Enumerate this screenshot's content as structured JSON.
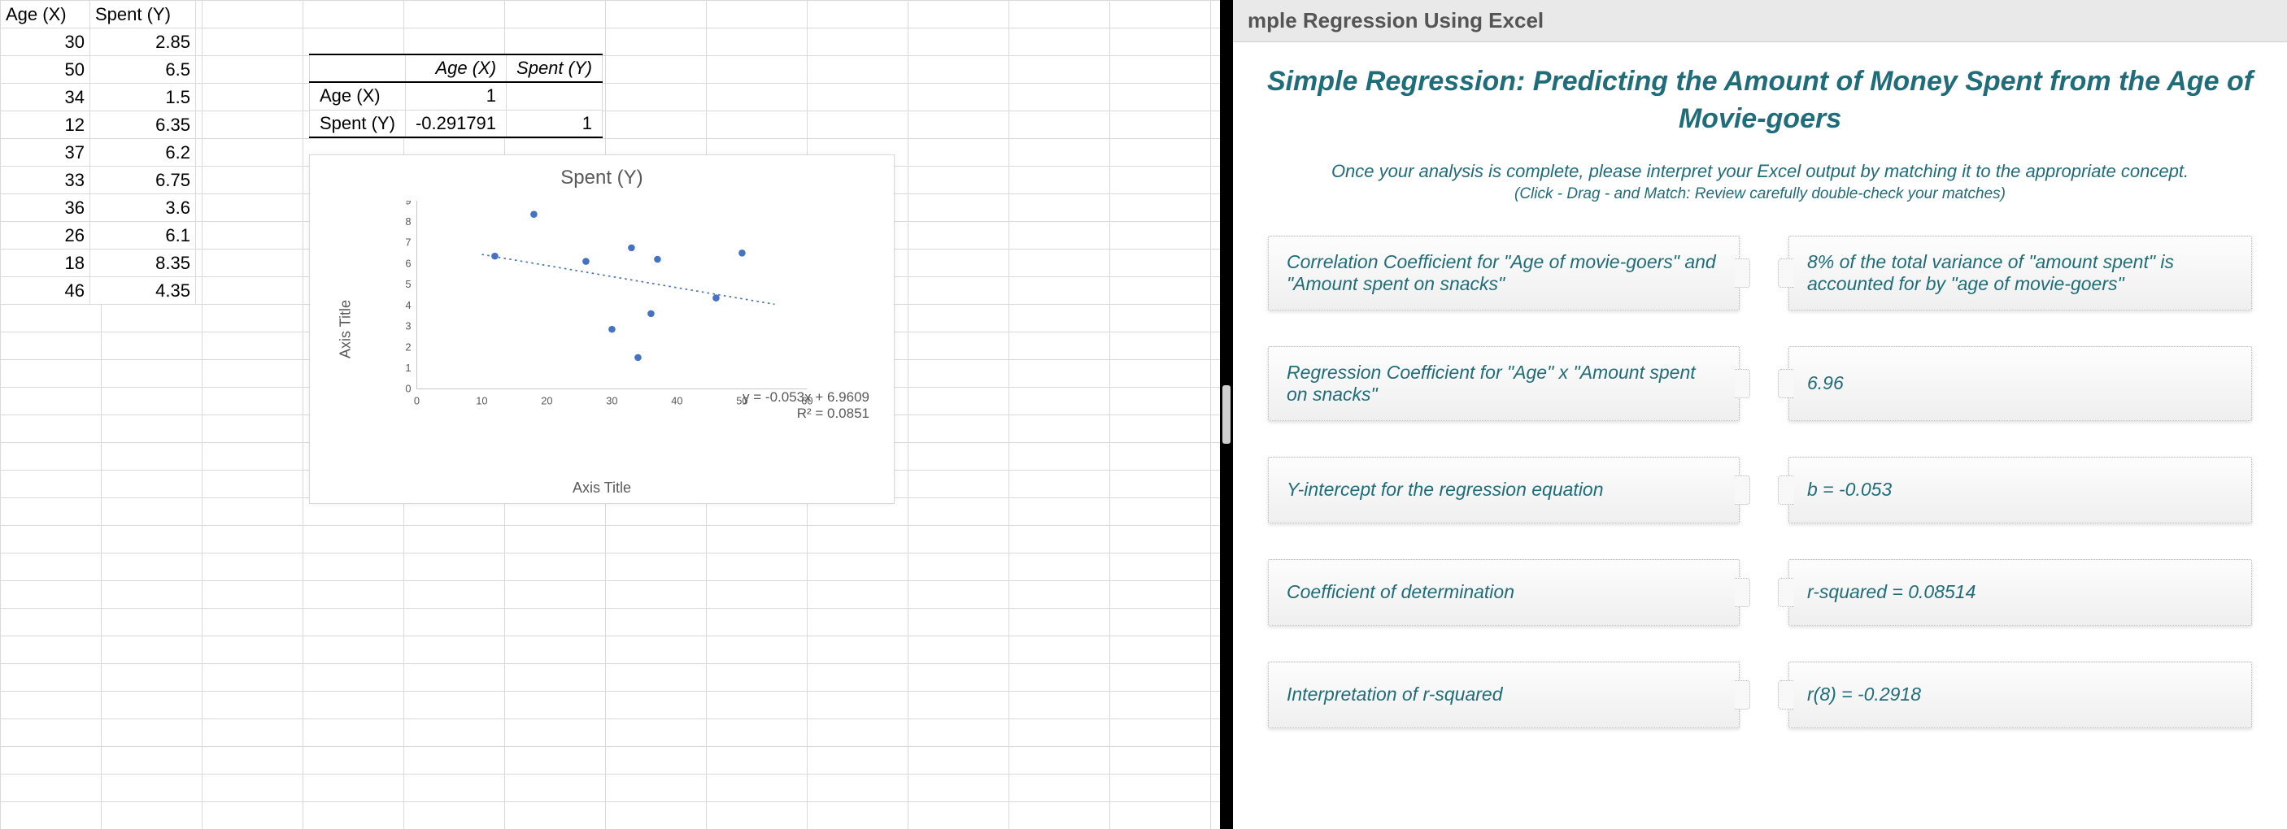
{
  "excel": {
    "headers": {
      "x": "Age (X)",
      "y": "Spent (Y)"
    },
    "rows": [
      {
        "x": 30,
        "y": 2.85
      },
      {
        "x": 50,
        "y": 6.5
      },
      {
        "x": 34,
        "y": 1.5
      },
      {
        "x": 12,
        "y": 6.35
      },
      {
        "x": 37,
        "y": 6.2
      },
      {
        "x": 33,
        "y": 6.75
      },
      {
        "x": 36,
        "y": 3.6
      },
      {
        "x": 26,
        "y": 6.1
      },
      {
        "x": 18,
        "y": 8.35
      },
      {
        "x": 46,
        "y": 4.35
      }
    ],
    "correlation_table": {
      "col_labels": {
        "x": "Age (X)",
        "y": "Spent (Y)"
      },
      "row_labels": {
        "x": "Age (X)",
        "y": "Spent (Y)"
      },
      "xx": 1,
      "yx": -0.291791,
      "yy": 1
    }
  },
  "chart_data": {
    "type": "scatter",
    "title": "Spent (Y)",
    "xlabel": "Axis Title",
    "ylabel": "Axis Title",
    "xlim": [
      0,
      60
    ],
    "ylim": [
      0,
      9
    ],
    "xticks": [
      0,
      10,
      20,
      30,
      40,
      50,
      60
    ],
    "yticks": [
      0,
      1,
      2,
      3,
      4,
      5,
      6,
      7,
      8,
      9
    ],
    "points": [
      {
        "x": 30,
        "y": 2.85
      },
      {
        "x": 50,
        "y": 6.5
      },
      {
        "x": 34,
        "y": 1.5
      },
      {
        "x": 12,
        "y": 6.35
      },
      {
        "x": 37,
        "y": 6.2
      },
      {
        "x": 33,
        "y": 6.75
      },
      {
        "x": 36,
        "y": 3.6
      },
      {
        "x": 26,
        "y": 6.1
      },
      {
        "x": 18,
        "y": 8.35
      },
      {
        "x": 46,
        "y": 4.35
      }
    ],
    "trendline": {
      "slope": -0.053,
      "intercept": 6.9609
    },
    "equation_text": "y = -0.053x + 6.9609",
    "r2_text": "R² = 0.0851"
  },
  "lesson": {
    "header": "mple Regression Using Excel",
    "title": "Simple Regression: Predicting the Amount of Money Spent from the Age of Movie-goers",
    "instructions": "Once your analysis is complete, please interpret your Excel output by matching it to the appropriate concept.",
    "sub_instructions": "(Click - Drag - and Match: Review carefully double-check your matches)",
    "left": [
      "Correlation Coefficient for \"Age of movie-goers\" and \"Amount spent on snacks\"",
      "Regression Coefficient for \"Age\" x \"Amount spent on snacks\"",
      "Y-intercept for the regression equation",
      "Coefficient of determination",
      "Interpretation of r-squared"
    ],
    "right": [
      "8% of the total variance of \"amount spent\" is accounted for by \"age of movie-goers\"",
      "6.96",
      "b = -0.053",
      "r-squared = 0.08514",
      "r(8) = -0.2918"
    ]
  }
}
